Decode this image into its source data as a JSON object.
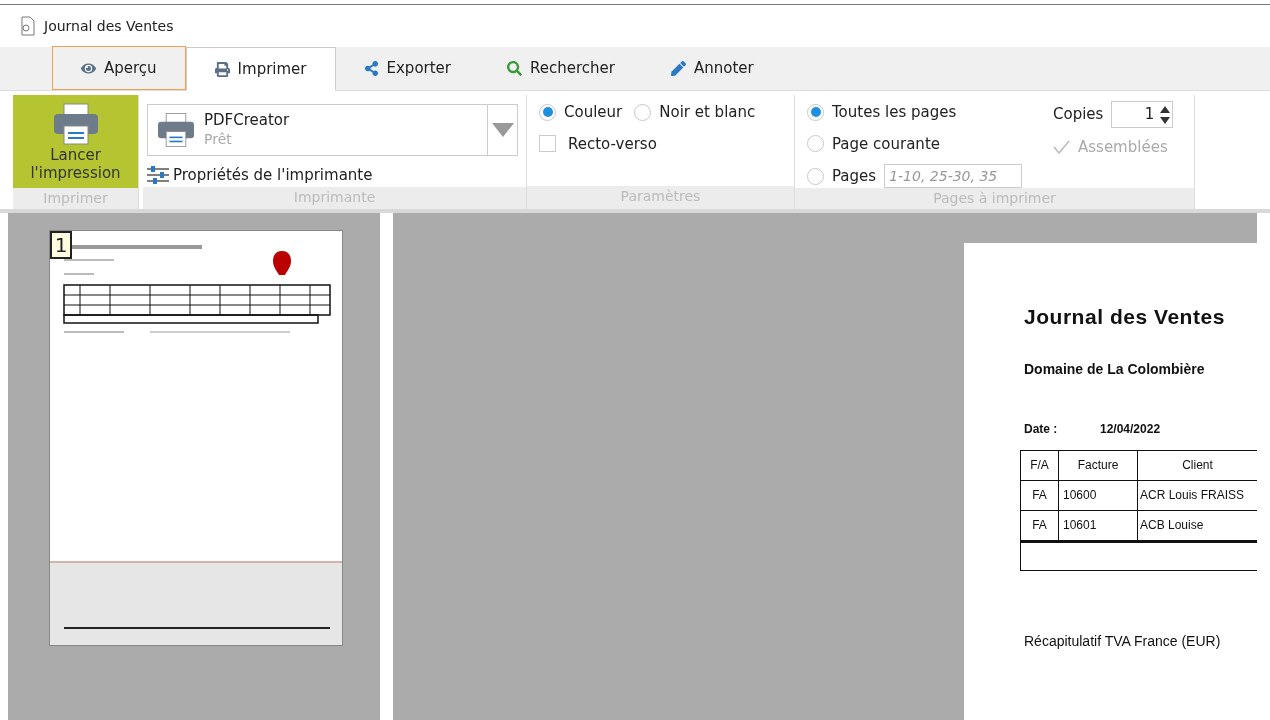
{
  "window": {
    "title": "Journal des Ventes"
  },
  "tabs": [
    {
      "label": "Aperçu",
      "kind": "eye",
      "selected": false,
      "focused": true
    },
    {
      "label": "Imprimer",
      "kind": "printer",
      "selected": true,
      "focused": false
    },
    {
      "label": "Exporter",
      "kind": "share",
      "selected": false,
      "focused": false
    },
    {
      "label": "Rechercher",
      "kind": "search",
      "selected": false,
      "focused": false
    },
    {
      "label": "Annoter",
      "kind": "pencil",
      "selected": false,
      "focused": false
    }
  ],
  "ribbon": {
    "print_button": "Lancer l'impression",
    "printer": {
      "name": "PDFCreator",
      "status": "Prêt",
      "properties_link": "Propriétés de l'imprimante"
    },
    "color_options": [
      {
        "label": "Couleur",
        "selected": true
      },
      {
        "label": "Noir et blanc",
        "selected": false
      }
    ],
    "duplex": {
      "label": "Recto-verso",
      "checked": false
    },
    "page_options": [
      {
        "label": "Toutes les pages",
        "selected": true
      },
      {
        "label": "Page courante",
        "selected": false
      },
      {
        "label": "Pages",
        "selected": false
      }
    ],
    "pages_field": {
      "placeholder": "1-10, 25-30, 35"
    },
    "copies": {
      "label": "Copies",
      "value": "1"
    },
    "collate": {
      "label": "Assemblées",
      "checked": true,
      "disabled": true
    },
    "groups": [
      "Imprimer",
      "Imprimante",
      "Paramètres",
      "Pages à imprimer"
    ]
  },
  "thumbnails": [
    {
      "number": "1",
      "selected": true
    }
  ],
  "page": {
    "title": "Journal des Ventes",
    "company": "Domaine de La Colombière",
    "date_label": "Date :",
    "date": "12/04/2022",
    "columns": [
      "F/A",
      "Facture",
      "Client"
    ],
    "rows": [
      [
        "FA",
        "10600",
        "ACR Louis FRAISS"
      ],
      [
        "FA",
        "10601",
        "ACB Louise"
      ]
    ],
    "summary_title": "Récapitulatif TVA France (EUR)"
  }
}
